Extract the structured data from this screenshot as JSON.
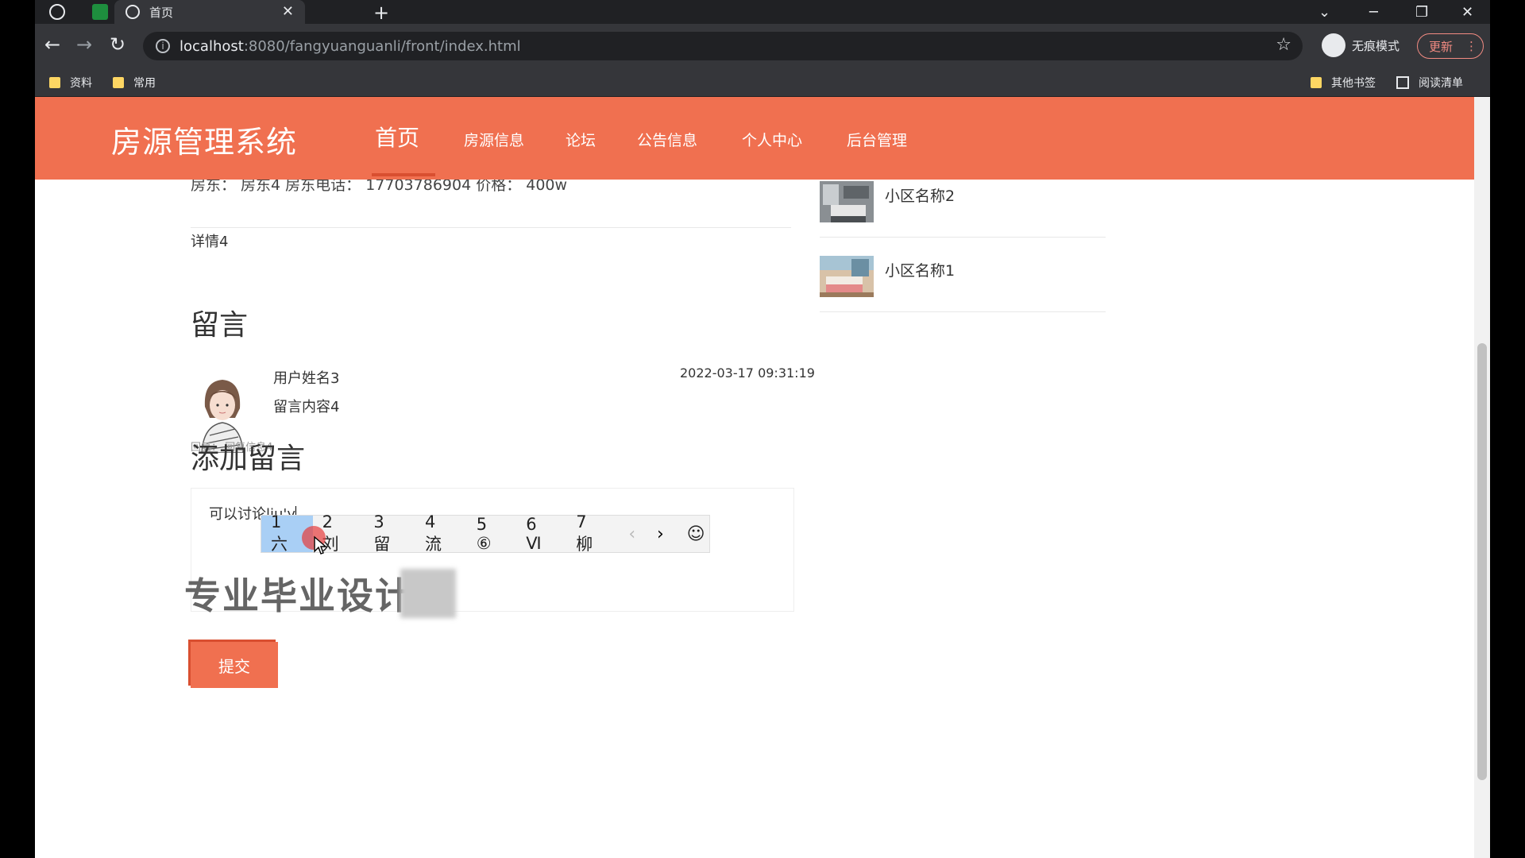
{
  "browser": {
    "active_tab_title": "首页",
    "url_host": "localhost",
    "url_rest": ":8080/fangyuanguanli/front/index.html",
    "incognito_label": "无痕模式",
    "update_label": "更新",
    "bookmarks": [
      "资料",
      "常用"
    ],
    "other_bookmarks": "其他书签",
    "reading_list": "阅读清单"
  },
  "site": {
    "logo": "房源管理系统",
    "nav": [
      "首页",
      "房源信息",
      "论坛",
      "公告信息",
      "个人中心",
      "后台管理"
    ]
  },
  "listing": {
    "info_line": "房东：  房东4    房东电话：  17703786904    价格：  400w",
    "detail": "详情4"
  },
  "comments": {
    "heading": "留言",
    "items": [
      {
        "username": "用户姓名3",
        "content": "留言内容4",
        "time": "2022-03-17 09:31:19",
        "reply": "回复：  回复信息4"
      }
    ]
  },
  "add_comment": {
    "heading": "添加留言",
    "input_text": "可以讨论liu'y",
    "submit_label": "提交"
  },
  "ime": {
    "candidates": [
      "1 六",
      "2 刘",
      "3 留",
      "4 流",
      "5 ⑥",
      "6 Ⅵ",
      "7 柳"
    ],
    "selected_index": 0
  },
  "watermark": "专业毕业设计",
  "sidebar": {
    "items": [
      {
        "title": "小区名称2"
      },
      {
        "title": "小区名称1"
      }
    ]
  }
}
